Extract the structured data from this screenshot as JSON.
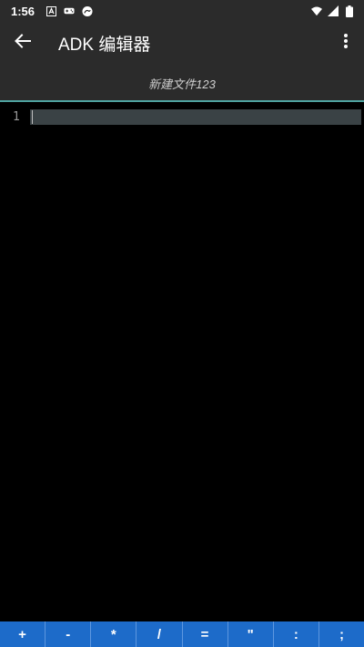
{
  "status_bar": {
    "time": "1:56",
    "icons": [
      "a-notification-icon",
      "game-controller-icon",
      "cast-icon"
    ],
    "right_icons": [
      "wifi-icon",
      "signal-icon",
      "battery-icon"
    ]
  },
  "app_bar": {
    "title": "ADK 编辑器",
    "back_icon": "arrow-back-icon",
    "menu_icon": "more-vert-icon"
  },
  "file": {
    "name": "新建文件123"
  },
  "editor": {
    "lines": [
      {
        "number": "1",
        "text": ""
      }
    ]
  },
  "symbol_bar": {
    "keys": [
      "+",
      "-",
      "*",
      "/",
      "=",
      "\"",
      ":",
      ";"
    ]
  },
  "colors": {
    "bar": "#2b2b2b",
    "accent_line": "#4fa3a0",
    "symbol_bar": "#1d6bc9",
    "current_line": "#3a4245"
  }
}
